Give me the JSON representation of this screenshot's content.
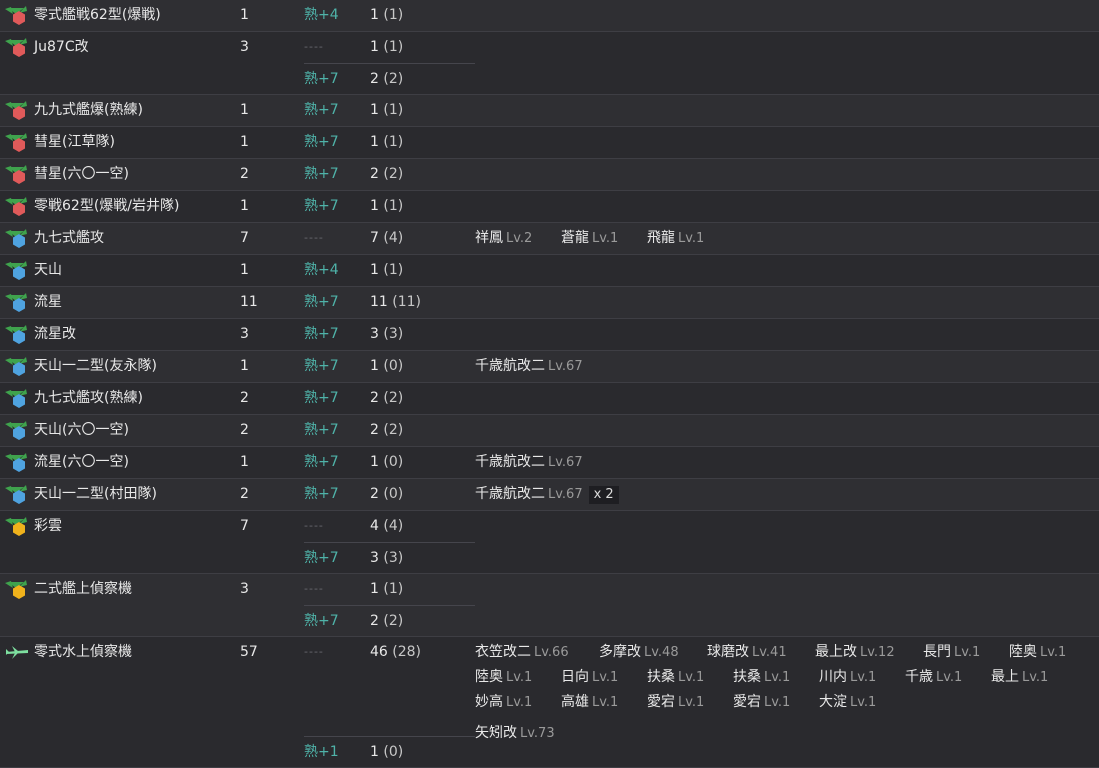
{
  "rows": [
    {
      "icon": "red",
      "name": "零式艦戦62型(爆戦)",
      "count": "1",
      "details": [
        {
          "prof": "熟+4",
          "amount": "1",
          "paren": "(1)",
          "ships": []
        }
      ]
    },
    {
      "icon": "red",
      "name": "Ju87C改",
      "count": "3",
      "details": [
        {
          "prof": "----",
          "amount": "1",
          "paren": "(1)",
          "ships": []
        },
        {
          "prof": "熟+7",
          "amount": "2",
          "paren": "(2)",
          "ships": []
        }
      ]
    },
    {
      "icon": "red",
      "name": "九九式艦爆(熟練)",
      "count": "1",
      "details": [
        {
          "prof": "熟+7",
          "amount": "1",
          "paren": "(1)",
          "ships": []
        }
      ]
    },
    {
      "icon": "red",
      "name": "彗星(江草隊)",
      "count": "1",
      "details": [
        {
          "prof": "熟+7",
          "amount": "1",
          "paren": "(1)",
          "ships": []
        }
      ]
    },
    {
      "icon": "red",
      "name": "彗星(六〇一空)",
      "count": "2",
      "details": [
        {
          "prof": "熟+7",
          "amount": "2",
          "paren": "(2)",
          "ships": []
        }
      ]
    },
    {
      "icon": "red",
      "name": "零戦62型(爆戦/岩井隊)",
      "count": "1",
      "details": [
        {
          "prof": "熟+7",
          "amount": "1",
          "paren": "(1)",
          "ships": []
        }
      ]
    },
    {
      "icon": "blue",
      "name": "九七式艦攻",
      "count": "7",
      "details": [
        {
          "prof": "----",
          "amount": "7",
          "paren": "(4)",
          "ships": [
            {
              "name": "祥鳳",
              "lv": "Lv.2"
            },
            {
              "name": "蒼龍",
              "lv": "Lv.1"
            },
            {
              "name": "飛龍",
              "lv": "Lv.1"
            }
          ]
        }
      ]
    },
    {
      "icon": "blue",
      "name": "天山",
      "count": "1",
      "details": [
        {
          "prof": "熟+4",
          "amount": "1",
          "paren": "(1)",
          "ships": []
        }
      ]
    },
    {
      "icon": "blue",
      "name": "流星",
      "count": "11",
      "details": [
        {
          "prof": "熟+7",
          "amount": "11",
          "paren": "(11)",
          "ships": []
        }
      ]
    },
    {
      "icon": "blue",
      "name": "流星改",
      "count": "3",
      "details": [
        {
          "prof": "熟+7",
          "amount": "3",
          "paren": "(3)",
          "ships": []
        }
      ]
    },
    {
      "icon": "blue",
      "name": "天山一二型(友永隊)",
      "count": "1",
      "details": [
        {
          "prof": "熟+7",
          "amount": "1",
          "paren": "(0)",
          "ships": [
            {
              "name": "千歳航改二",
              "lv": "Lv.67"
            }
          ]
        }
      ]
    },
    {
      "icon": "blue",
      "name": "九七式艦攻(熟練)",
      "count": "2",
      "details": [
        {
          "prof": "熟+7",
          "amount": "2",
          "paren": "(2)",
          "ships": []
        }
      ]
    },
    {
      "icon": "blue",
      "name": "天山(六〇一空)",
      "count": "2",
      "details": [
        {
          "prof": "熟+7",
          "amount": "2",
          "paren": "(2)",
          "ships": []
        }
      ]
    },
    {
      "icon": "blue",
      "name": "流星(六〇一空)",
      "count": "1",
      "details": [
        {
          "prof": "熟+7",
          "amount": "1",
          "paren": "(0)",
          "ships": [
            {
              "name": "千歳航改二",
              "lv": "Lv.67"
            }
          ]
        }
      ]
    },
    {
      "icon": "blue",
      "name": "天山一二型(村田隊)",
      "count": "2",
      "details": [
        {
          "prof": "熟+7",
          "amount": "2",
          "paren": "(0)",
          "ships": [
            {
              "name": "千歳航改二",
              "lv": "Lv.67",
              "badge": "x 2"
            }
          ]
        }
      ]
    },
    {
      "icon": "yellow",
      "name": "彩雲",
      "count": "7",
      "details": [
        {
          "prof": "----",
          "amount": "4",
          "paren": "(4)",
          "ships": []
        },
        {
          "prof": "熟+7",
          "amount": "3",
          "paren": "(3)",
          "ships": []
        }
      ]
    },
    {
      "icon": "yellow",
      "name": "二式艦上偵察機",
      "count": "3",
      "details": [
        {
          "prof": "----",
          "amount": "1",
          "paren": "(1)",
          "ships": []
        },
        {
          "prof": "熟+7",
          "amount": "2",
          "paren": "(2)",
          "ships": []
        }
      ]
    },
    {
      "icon": "seaplane",
      "name": "零式水上偵察機",
      "count": "57",
      "details": [
        {
          "prof": "----",
          "amount": "46",
          "paren": "(28)",
          "ships": [
            {
              "name": "衣笠改二",
              "lv": "Lv.66"
            },
            {
              "name": "多摩改",
              "lv": "Lv.48"
            },
            {
              "name": "球磨改",
              "lv": "Lv.41"
            },
            {
              "name": "最上改",
              "lv": "Lv.12"
            },
            {
              "name": "長門",
              "lv": "Lv.1"
            },
            {
              "name": "陸奥",
              "lv": "Lv.1"
            },
            {
              "name": "陸奥",
              "lv": "Lv.1"
            },
            {
              "name": "日向",
              "lv": "Lv.1"
            },
            {
              "name": "扶桑",
              "lv": "Lv.1"
            },
            {
              "name": "扶桑",
              "lv": "Lv.1"
            },
            {
              "name": "川内",
              "lv": "Lv.1"
            },
            {
              "name": "千歳",
              "lv": "Lv.1"
            },
            {
              "name": "最上",
              "lv": "Lv.1"
            },
            {
              "name": "妙高",
              "lv": "Lv.1"
            },
            {
              "name": "高雄",
              "lv": "Lv.1"
            },
            {
              "name": "愛宕",
              "lv": "Lv.1"
            },
            {
              "name": "愛宕",
              "lv": "Lv.1"
            },
            {
              "name": "大淀",
              "lv": "Lv.1"
            }
          ]
        },
        {
          "prof": "熟+1",
          "amount": "1",
          "paren": "(0)",
          "ships": [
            {
              "name": "矢矧改",
              "lv": "Lv.73"
            }
          ]
        }
      ]
    }
  ],
  "colors": {
    "red": "#e05a5a",
    "blue": "#4fa3e0",
    "yellow": "#f0b21c",
    "leaf": "#3fa34d",
    "seaplane": "#7ee0a0"
  }
}
